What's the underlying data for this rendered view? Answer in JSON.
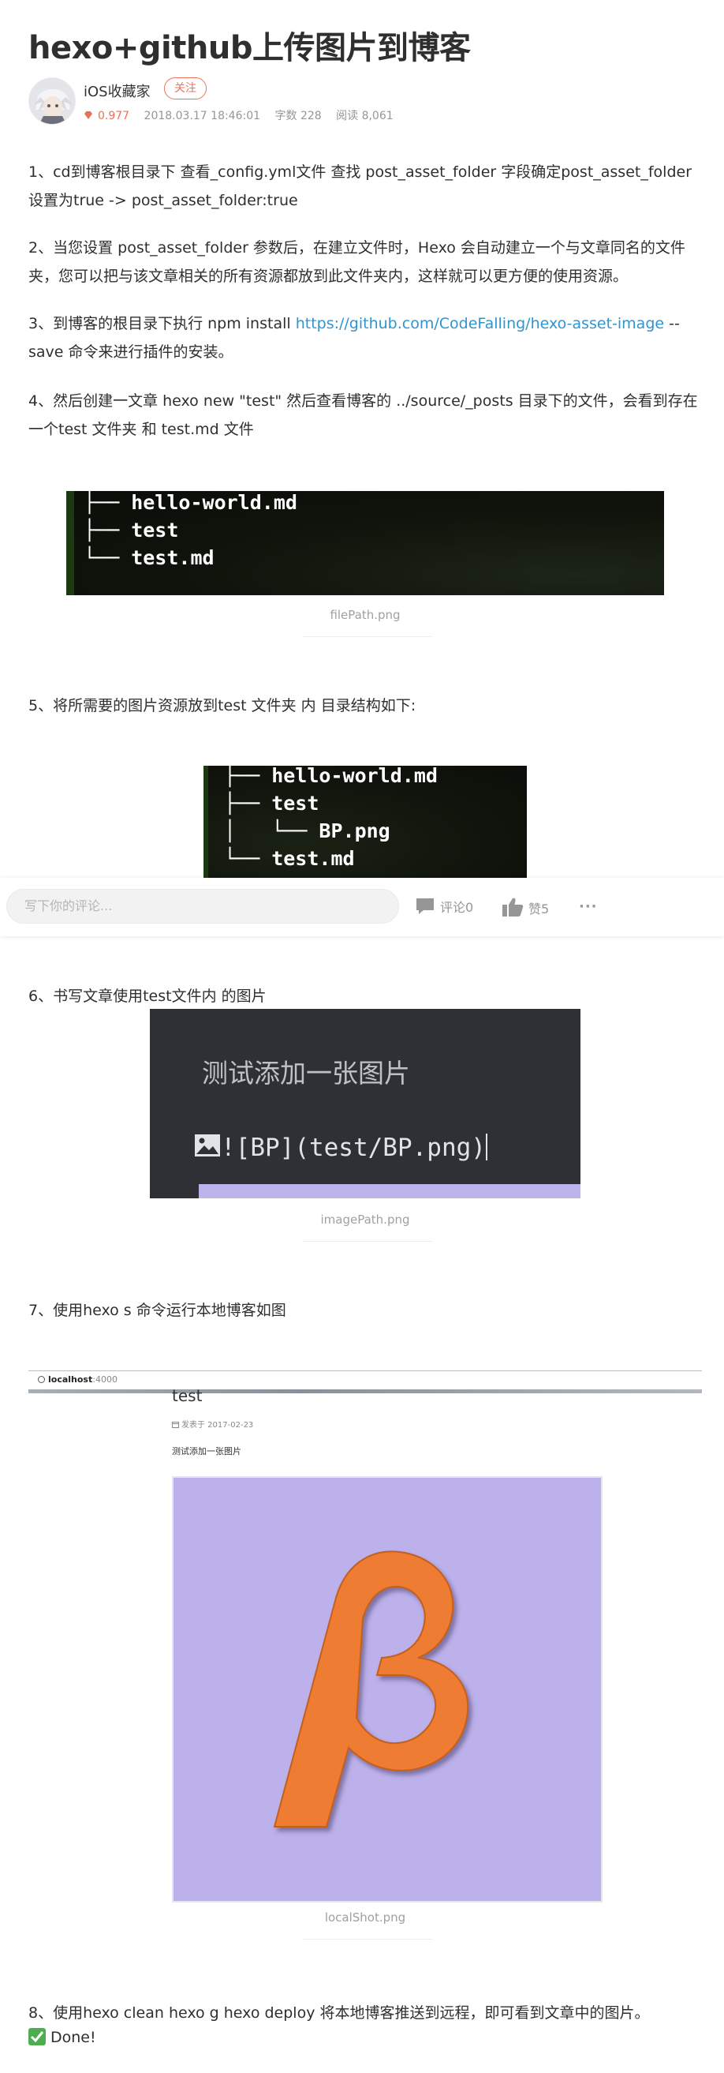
{
  "article": {
    "title": "hexo+github上传图片到博客",
    "author_name": "iOS收藏家",
    "follow_label": "关注",
    "score": "0.977",
    "date": "2018.03.17 18:46:01",
    "word_count": "字数 228",
    "read_count": "阅读 8,061"
  },
  "paragraphs": {
    "p1": "1、cd到博客根目录下 查看_config.yml文件 查找 post_asset_folder 字段确定post_asset_folder 设置为true -> post_asset_folder:true",
    "p2": "2、当您设置 post_asset_folder 参数后，在建立文件时，Hexo 会自动建立一个与文章同名的文件夹，您可以把与该文章相关的所有资源都放到此文件夹内，这样就可以更方便的使用资源。",
    "p3_before": "3、到博客的根目录下执行 npm install ",
    "p3_link": "https://github.com/CodeFalling/hexo-asset-image",
    "p3_after": " --save 命令来进行插件的安装。",
    "p4": "4、然后创建一文章 hexo new \"test\" 然后查看博客的 ../source/_posts 目录下的文件，会看到存在一个test 文件夹 和 test.md 文件",
    "p5": "5、将所需要的图片资源放到test 文件夹 内 目录结构如下:",
    "p6": "6、书写文章使用test文件内 的图片",
    "p7": "7、使用hexo s 命令运行本地博客如图",
    "p8": "8、使用hexo clean hexo g hexo deploy 将本地博客推送到远程，即可看到文章中的图片。",
    "done": "Done!"
  },
  "image1": {
    "lines": [
      "├── hello-world.md",
      "├── test",
      "└── test.md"
    ],
    "caption": "filePath.png"
  },
  "image2": {
    "lines": [
      "├── hello-world.md",
      "├── test",
      "│   └── BP.png",
      "└── test.md"
    ]
  },
  "image3": {
    "heading": "测试添加一张图片",
    "code": "![BP](test/BP.png)",
    "caption": "imagePath.png"
  },
  "image4": {
    "url_host": "localhost",
    "url_port": ":4000",
    "post_title": "test",
    "post_date": "发表于 2017-02-23",
    "post_body": "测试添加一张图片",
    "caption": "localShot.png"
  },
  "comment_bar": {
    "placeholder": "写下你的评论...",
    "comments_label": "评论0",
    "likes_label": "赞5",
    "more_label": "···"
  },
  "colors": {
    "accent": "#ec7259",
    "link": "#3194d0",
    "beta_orange": "#ee7b30",
    "beta_background": "#bdb1eb"
  }
}
